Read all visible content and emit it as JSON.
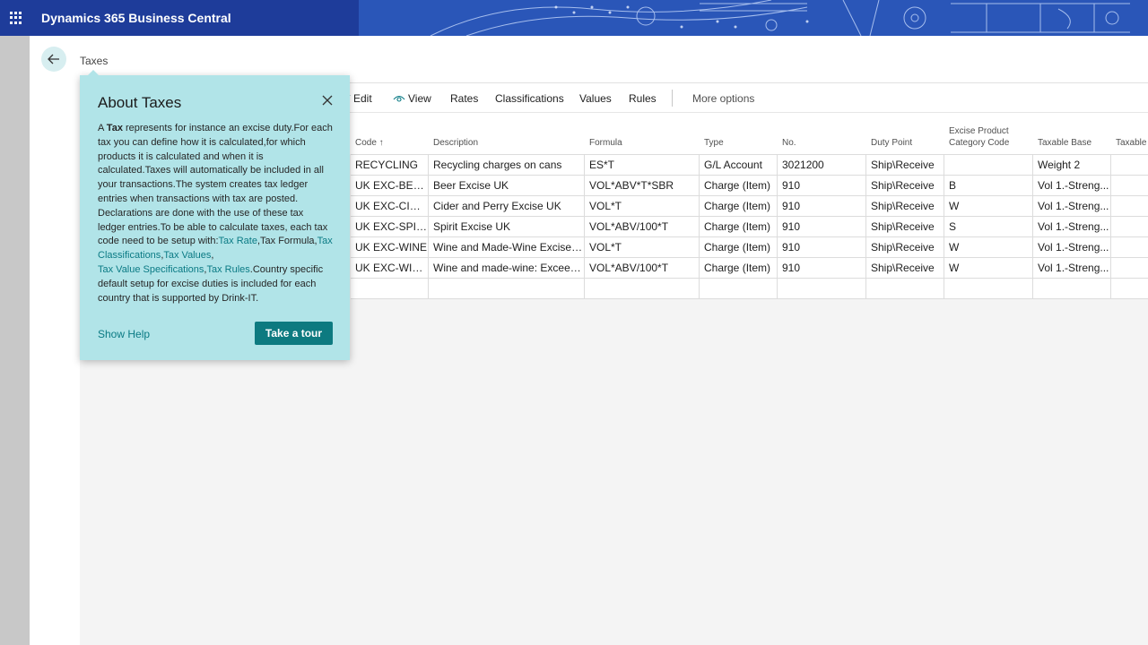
{
  "app": {
    "title": "Dynamics 365 Business Central"
  },
  "breadcrumb": {
    "label": "Taxes"
  },
  "actions": {
    "edit": "Edit",
    "view": "View",
    "rates": "Rates",
    "classifications": "Classifications",
    "values": "Values",
    "rules": "Rules",
    "more": "More options"
  },
  "grid": {
    "headers": {
      "code": "Code ↑",
      "description": "Description",
      "formula": "Formula",
      "type": "Type",
      "no": "No.",
      "duty_point": "Duty Point",
      "excise_line1": "Excise Product",
      "excise_line2": "Category Code",
      "taxable_base": "Taxable Base",
      "taxable": "Taxable"
    },
    "rows": [
      {
        "code": "RECYCLING",
        "description": "Recycling charges on cans",
        "formula": "ES*T",
        "type": "G/L Account",
        "no": "3021200",
        "duty_point": "Ship\\Receive",
        "excise": "",
        "taxable_base": "Weight 2"
      },
      {
        "code": "UK EXC-BEER",
        "description": "Beer Excise UK",
        "formula": "VOL*ABV*T*SBR",
        "type": "Charge (Item)",
        "no": "910",
        "duty_point": "Ship\\Receive",
        "excise": "B",
        "taxable_base": "Vol 1.-Streng..."
      },
      {
        "code": "UK EXC-CIDE...",
        "description": "Cider and Perry Excise UK",
        "formula": "VOL*T",
        "type": "Charge (Item)",
        "no": "910",
        "duty_point": "Ship\\Receive",
        "excise": "W",
        "taxable_base": "Vol 1.-Streng..."
      },
      {
        "code": "UK EXC-SPIRI...",
        "description": "Spirit Excise UK",
        "formula": "VOL*ABV/100*T",
        "type": "Charge (Item)",
        "no": "910",
        "duty_point": "Ship\\Receive",
        "excise": "S",
        "taxable_base": "Vol 1.-Streng..."
      },
      {
        "code": "UK EXC-WINE",
        "description": "Wine and Made-Wine Excise UK",
        "formula": "VOL*T",
        "type": "Charge (Item)",
        "no": "910",
        "duty_point": "Ship\\Receive",
        "excise": "W",
        "taxable_base": "Vol 1.-Streng..."
      },
      {
        "code": "UK EXC-WINE...",
        "description": "Wine and made-wine: Exceedi...",
        "formula": "VOL*ABV/100*T",
        "type": "Charge (Item)",
        "no": "910",
        "duty_point": "Ship\\Receive",
        "excise": "W",
        "taxable_base": "Vol 1.-Streng..."
      },
      {
        "code": "",
        "description": "",
        "formula": "",
        "type": "",
        "no": "",
        "duty_point": "",
        "excise": "",
        "taxable_base": ""
      }
    ]
  },
  "tip": {
    "title": "About Taxes",
    "body_1": "A ",
    "body_bold": "Tax",
    "body_2": " represents for instance an excise duty.For each tax you can define how it is calculated,for which products it is calculated and when it is calculated.Taxes will automatically be included in all your transactions.The system creates tax ledger entries when transactions with tax are posted. Declarations are done with the use of these tax ledger entries.To be able to calculate taxes, each tax code need to be setup with:",
    "link_rate": "Tax Rate",
    "body_3": ",Tax Formula,",
    "link_classifications": "Tax Classifications",
    "body_4": ",",
    "link_values": "Tax Values",
    "body_5": ",",
    "link_value_specs": "Tax Value Specifications",
    "body_6": ",",
    "link_rules": "Tax Rules",
    "body_7": ".Country specific default setup for excise duties is included for each country that is supported by Drink-IT.",
    "show_help": "Show Help",
    "take_tour": "Take a tour"
  },
  "colors": {
    "header_bg": "#1e3c9a",
    "tip_bg": "#b1e4e8",
    "accent": "#0d7a80",
    "link": "#0a7a84"
  }
}
